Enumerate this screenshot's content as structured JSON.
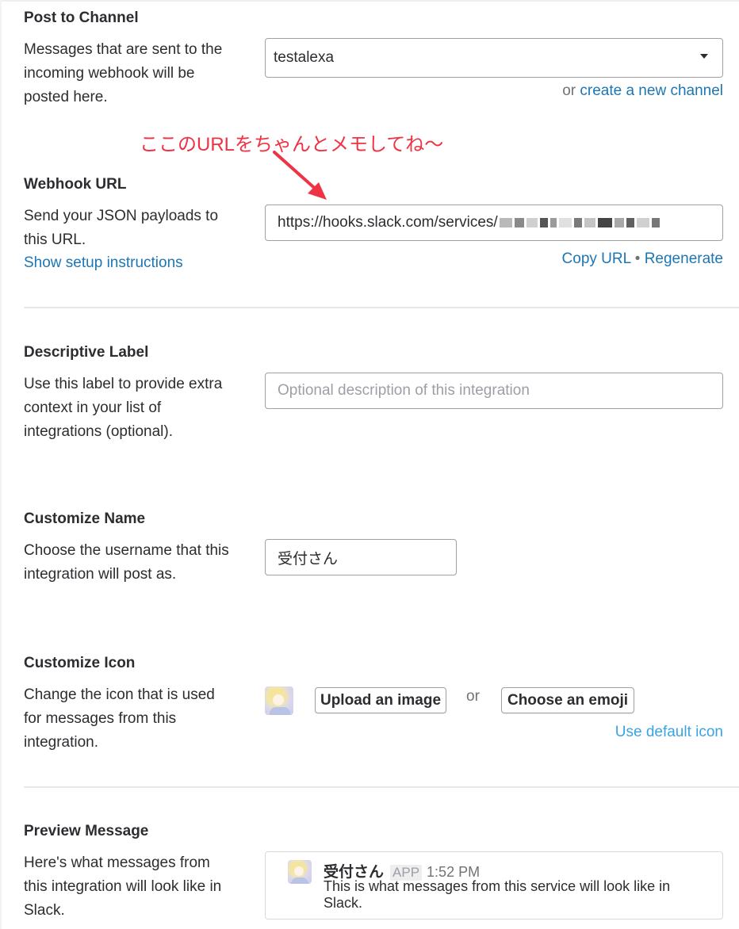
{
  "post_to_channel": {
    "heading": "Post to Channel",
    "desc_lines": [
      "Messages that are sent to the",
      "incoming webhook will be",
      "posted here."
    ],
    "selected_channel": "testalexa",
    "or_text": "or",
    "create_channel_link": "create a new channel"
  },
  "annotation": {
    "text": "ここのURLをちゃんとメモしてね〜",
    "color": "#ee3344"
  },
  "webhook": {
    "heading": "Webhook URL",
    "desc_lines": [
      "Send your JSON payloads to",
      "this URL."
    ],
    "setup_link": "Show setup instructions",
    "url_value": "https://hooks.slack.com/services/",
    "copy_link": "Copy URL",
    "separator": "•",
    "regenerate_link": "Regenerate"
  },
  "descriptive_label": {
    "heading": "Descriptive Label",
    "desc_lines": [
      "Use this label to provide extra",
      "context in your list of",
      "integrations (optional)."
    ],
    "placeholder": "Optional description of this integration"
  },
  "customize_name": {
    "heading": "Customize Name",
    "desc_lines": [
      "Choose the username that this",
      "integration will post as."
    ],
    "value": "受付さん"
  },
  "customize_icon": {
    "heading": "Customize Icon",
    "desc_lines": [
      "Change the icon that is used",
      "for messages from this",
      "integration."
    ],
    "upload_button": "Upload an image",
    "or_text": "or",
    "emoji_button": "Choose an emoji",
    "default_link": "Use default icon"
  },
  "preview_message": {
    "heading": "Preview Message",
    "desc_lines": [
      "Here's what messages from",
      "this integration will look like in",
      "Slack."
    ],
    "sender": "受付さん",
    "app_badge": "APP",
    "time": "1:52 PM",
    "text_lines": [
      "This is what messages from this service will look like in",
      "Slack."
    ]
  },
  "colors": {
    "link": "#1d76b4",
    "text": "#2c2d30",
    "border": "#a0a0a2"
  }
}
